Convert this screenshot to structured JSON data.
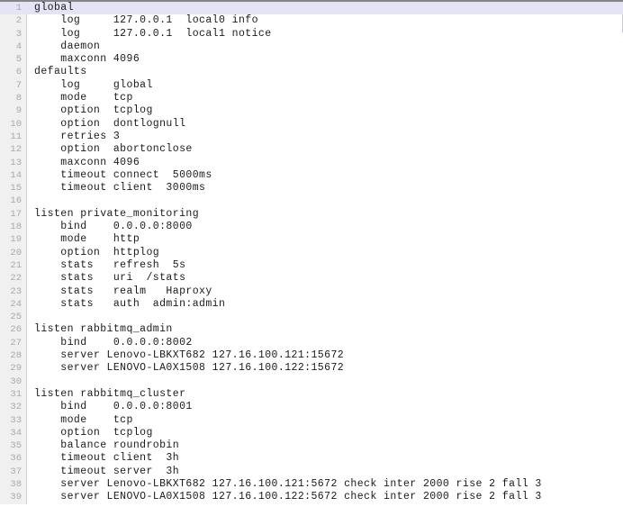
{
  "editor": {
    "name": "code-editor",
    "language": "haproxy-config",
    "total_lines": 39,
    "current_line": 1,
    "colors": {
      "background": "#ffffff",
      "gutter_background": "#f0f0f0",
      "gutter_text": "#a9a9a9",
      "gutter_border": "#d2d2d2",
      "text": "#1a1a1a",
      "current_line_highlight": "#e4e4f7",
      "top_border": "#858585"
    },
    "lines": [
      {
        "number": "1",
        "text": "global"
      },
      {
        "number": "2",
        "text": "    log     127.0.0.1  local0 info"
      },
      {
        "number": "3",
        "text": "    log     127.0.0.1  local1 notice"
      },
      {
        "number": "4",
        "text": "    daemon"
      },
      {
        "number": "5",
        "text": "    maxconn 4096"
      },
      {
        "number": "6",
        "text": "defaults"
      },
      {
        "number": "7",
        "text": "    log     global"
      },
      {
        "number": "8",
        "text": "    mode    tcp"
      },
      {
        "number": "9",
        "text": "    option  tcplog"
      },
      {
        "number": "10",
        "text": "    option  dontlognull"
      },
      {
        "number": "11",
        "text": "    retries 3"
      },
      {
        "number": "12",
        "text": "    option  abortonclose"
      },
      {
        "number": "13",
        "text": "    maxconn 4096"
      },
      {
        "number": "14",
        "text": "    timeout connect  5000ms"
      },
      {
        "number": "15",
        "text": "    timeout client  3000ms"
      },
      {
        "number": "16",
        "text": ""
      },
      {
        "number": "17",
        "text": "listen private_monitoring"
      },
      {
        "number": "18",
        "text": "    bind    0.0.0.0:8000"
      },
      {
        "number": "19",
        "text": "    mode    http"
      },
      {
        "number": "20",
        "text": "    option  httplog"
      },
      {
        "number": "21",
        "text": "    stats   refresh  5s"
      },
      {
        "number": "22",
        "text": "    stats   uri  /stats"
      },
      {
        "number": "23",
        "text": "    stats   realm   Haproxy"
      },
      {
        "number": "24",
        "text": "    stats   auth  admin:admin"
      },
      {
        "number": "25",
        "text": ""
      },
      {
        "number": "26",
        "text": "listen rabbitmq_admin"
      },
      {
        "number": "27",
        "text": "    bind    0.0.0.0:8002"
      },
      {
        "number": "28",
        "text": "    server Lenovo-LBKXT682 127.16.100.121:15672"
      },
      {
        "number": "29",
        "text": "    server LENOVO-LA0X1508 127.16.100.122:15672"
      },
      {
        "number": "30",
        "text": ""
      },
      {
        "number": "31",
        "text": "listen rabbitmq_cluster"
      },
      {
        "number": "32",
        "text": "    bind    0.0.0.0:8001"
      },
      {
        "number": "33",
        "text": "    mode    tcp"
      },
      {
        "number": "34",
        "text": "    option  tcplog"
      },
      {
        "number": "35",
        "text": "    balance roundrobin"
      },
      {
        "number": "36",
        "text": "    timeout client  3h"
      },
      {
        "number": "37",
        "text": "    timeout server  3h"
      },
      {
        "number": "38",
        "text": "    server Lenovo-LBKXT682 127.16.100.121:5672 check inter 2000 rise 2 fall 3"
      },
      {
        "number": "39",
        "text": "    server LENOVO-LA0X1508 127.16.100.122:5672 check inter 2000 rise 2 fall 3"
      }
    ]
  }
}
